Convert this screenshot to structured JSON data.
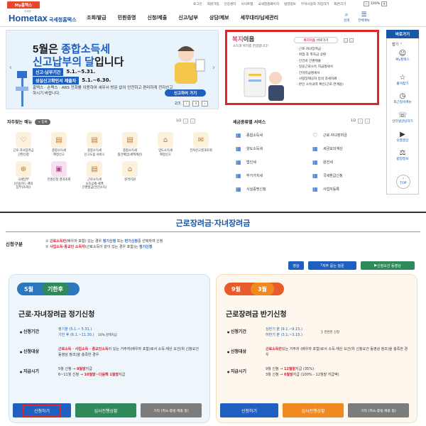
{
  "util": {
    "my_tab": "My홈택스",
    "links": [
      "로그인",
      "회원가입",
      "인증센터",
      "사이트맵",
      "국세청홈페이지",
      "법령정보",
      "부서사용자 가입하기",
      "화면크기"
    ],
    "zoom": "100%"
  },
  "header": {
    "logo": "Hometax",
    "logo_sub": "국세청홈택스",
    "logo_tiny": "국세청",
    "menu": [
      "조회/발급",
      "민원증명",
      "신청/제출",
      "신고/납부",
      "상담/제보",
      "세무대리/납세관리"
    ],
    "search_label": "검색",
    "allmenu_label": "전체메뉴"
  },
  "banner": {
    "line1_a": "5월은 ",
    "line1_hl": "종합소득세",
    "line2_hl": "신고납부의 달",
    "line2_b": "입니다",
    "rows": [
      {
        "label": "신고·납부기간",
        "value": "5.1.~5.31."
      },
      {
        "label": "성실신고확인서 제출자",
        "value": "5.1.~6.30."
      }
    ],
    "desc": "홈택스 · 손택스 · ARS 전화를 이용하여 세무서 방문 없이 안전하고 편리하게 전자신고 하시기 바랍니다.",
    "cta": "신고하러 가기",
    "pager": "2/3"
  },
  "welfare": {
    "title_hl": "복지",
    "title_b": "이음",
    "subtitle": "소득과 복지를 연결합니다!",
    "chip_hl": "복지이음",
    "chip_b": "바로가기",
    "items": [
      "근로·자녀장려금",
      "취업 후 학자금 상환",
      "인건비 간편제출",
      "일용근로소득 지급명세서",
      "간이지급명세서",
      "사업장제공자 등의 과세자료",
      "본인 소득내역 확인(근로·연계용)"
    ]
  },
  "quick": {
    "head": "바로가기",
    "toggle": "접기 ⌃",
    "items": [
      {
        "icon": "person-icon",
        "glyph": "☺",
        "label": "My홈택스"
      },
      {
        "icon": "star-icon",
        "glyph": "☆",
        "label": "즐겨찾기"
      },
      {
        "icon": "history-icon",
        "glyph": "◷",
        "label": "최근접속메뉴"
      },
      {
        "icon": "headset-icon",
        "glyph": "☏",
        "label": "인터넷상담하기"
      },
      {
        "icon": "play-icon",
        "glyph": "▶",
        "label": "숏폼영상"
      },
      {
        "icon": "gavel-icon",
        "glyph": "⚖",
        "label": "법령정보"
      }
    ],
    "top": "TOP"
  },
  "frequent": {
    "title": "자주찾는 메뉴",
    "add": "+ 등록",
    "pager": "1/2",
    "items": [
      {
        "glyph": "♡",
        "label": "근로·자녀장려금\n간편신청",
        "pink": false
      },
      {
        "glyph": "▤",
        "label": "종합소득세\n확정신고",
        "pink": false
      },
      {
        "glyph": "▤",
        "label": "종합소득세\n신고도움 서비스",
        "pink": false
      },
      {
        "glyph": "▤",
        "label": "종합소득세\n종간예납(세액계산)",
        "pink": false
      },
      {
        "glyph": "⌂",
        "label": "양도소득세\n확정신고",
        "pink": false
      },
      {
        "glyph": "✉",
        "label": "전자신고결과조회",
        "pink": false
      },
      {
        "glyph": "⊕",
        "label": "국세납부\n(신용카드·계좌\n납부(조회))",
        "pink": false
      },
      {
        "glyph": "▣",
        "label": "민원신청 결과조회",
        "pink": true
      },
      {
        "glyph": "▤",
        "label": "근로소득세\n소득공제·세액\n간편발급(연간소득)",
        "pink": false
      },
      {
        "glyph": "⌂",
        "label": "원격지원",
        "pink": false
      }
    ]
  },
  "services": {
    "title": "세금종류별 서비스",
    "pager": "1/2",
    "items": [
      {
        "glyph": "▦",
        "label": "종합소득세"
      },
      {
        "glyph": "♡",
        "label": "근로·자녀장려금"
      },
      {
        "glyph": "▦",
        "label": "양도소득세"
      },
      {
        "glyph": "▦",
        "label": "세금모의계산"
      },
      {
        "glyph": "▦",
        "label": "법인세"
      },
      {
        "glyph": "▦",
        "label": "원천세"
      },
      {
        "glyph": "▦",
        "label": "부가가치세"
      },
      {
        "glyph": "▦",
        "label": "국세환급신청"
      },
      {
        "glyph": "▦",
        "label": "사실증명신청"
      },
      {
        "glyph": "▦",
        "label": "사업자등록"
      }
    ]
  },
  "bottom": {
    "title": "근로장려금·자녀장려금",
    "section_label": "신청구분",
    "line1": {
      "num": "①",
      "red": "근로소득만",
      "a": "(배우자 포함) 있는 경우 ",
      "blue1": "정기신청",
      "b": " 또는 ",
      "blue2": "반기신청",
      "c": "중 선택하여 신청"
    },
    "line2": {
      "num": "②",
      "red": "사업소득·종교인 소득자",
      "a": "(근로소득이 같이 있는 경우 포함)는 ",
      "blue": "정기신청"
    },
    "buttons": {
      "video": "영상",
      "faq": "자주 묻는 질문",
      "req": "신청요건 동영상"
    }
  },
  "card_regular": {
    "month": "5월",
    "tag": "기한후",
    "title": "근로·자녀장려금 정기신청",
    "rows": {
      "period_label": "신청기간",
      "period_1_blue": "정기분 (5.1.~ 5.31.)",
      "period_2_blue": "기한 후 (6.1.~11.30.)",
      "period_2_note": "10% 감액지급",
      "target_label": "신청대상",
      "target_red": "근로소득 · 사업소득 · 종교인소득",
      "target_text": "이 있는 거주자(배우자 포함)로서 소득·재산 요건(위 신청요건 동영상 참조)을 충족한 경우",
      "pay_label": "지급시기",
      "pay_1a": "5월 신청 → ",
      "pay_1red": "8월말",
      "pay_1b": "지급",
      "pay_2a": "6~11월 신청 → ",
      "pay_2red": "10월말~다음해 1월말",
      "pay_2b": "지급"
    },
    "buttons": {
      "apply": "신청하기",
      "status": "심사진행상황",
      "etc": "기타 (취소·증빙·제출 등)"
    }
  },
  "card_half": {
    "month": "9월",
    "tag": "3월",
    "title": "근로장려금 반기신청",
    "rows": {
      "period_label": "신청기간",
      "period_1_blue": "상반기 분 (9.1.~9.15.)",
      "period_2_blue": "하반기 분 (3.1.~3.15.)",
      "period_note": "한번만 신청",
      "target_label": "신청대상",
      "target_red": "근로소득만",
      "target_text": "있는 거주자 (배우자 포함)로서 소득·재산 요건(위 신청요건 동영상 참조)을 충족한 경우",
      "pay_label": "지급시기",
      "pay_1a": "9월 신청 → ",
      "pay_1red": "12월말",
      "pay_1b": "지급 (35%)",
      "pay_2a": "3월 신청 → ",
      "pay_2red": "6월말",
      "pay_2b": "지급 (100% - 12월말 지급액)"
    },
    "buttons": {
      "apply": "신청하기",
      "status": "심사진행상황",
      "etc": "기타 (취소·증빙·제출 등)"
    }
  },
  "colors": {
    "brand": "#1856a8",
    "red": "#e12525",
    "green": "#2f8a5a",
    "orange": "#f0891f"
  }
}
